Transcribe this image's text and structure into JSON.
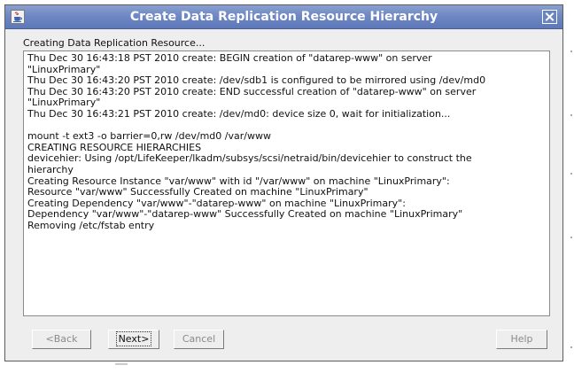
{
  "window": {
    "title": "Create Data Replication Resource Hierarchy",
    "app_icon": "java-app-icon",
    "close_icon": "close-icon"
  },
  "status": {
    "caption": "Creating Data Replication Resource..."
  },
  "log": {
    "lines": [
      "Thu Dec 30 16:43:18 PST 2010 create: BEGIN creation of \"datarep-www\" on server",
      "\"LinuxPrimary\"",
      "Thu Dec 30 16:43:20 PST 2010 create: /dev/sdb1 is configured to be mirrored using /dev/md0",
      "Thu Dec 30 16:43:20 PST 2010 create: END successful creation of \"datarep-www\" on server",
      "\"LinuxPrimary\"",
      "Thu Dec 30 16:43:21 PST 2010 create: /dev/md0: device size 0, wait for initialization...",
      "",
      "mount -t ext3 -o barrier=0,rw /dev/md0 /var/www",
      "CREATING RESOURCE HIERARCHIES",
      "devicehier: Using /opt/LifeKeeper/lkadm/subsys/scsi/netraid/bin/devicehier to construct the",
      "hierarchy",
      "Creating Resource Instance \"var/www\" with id \"/var/www\" on machine \"LinuxPrimary\":",
      "Resource \"var/www\" Successfully Created on machine \"LinuxPrimary\"",
      "Creating Dependency \"var/www\"-\"datarep-www\" on machine \"LinuxPrimary\":",
      "Dependency \"var/www\"-\"datarep-www\" Successfully Created on machine \"LinuxPrimary\"",
      "Removing /etc/fstab entry"
    ]
  },
  "buttons": {
    "back": "<Back",
    "next": "Next>",
    "cancel": "Cancel",
    "help": "Help"
  }
}
